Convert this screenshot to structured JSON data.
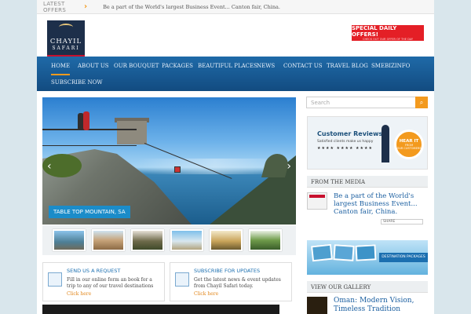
{
  "ticker": {
    "label": "LATEST OFFERS",
    "text": "Be a part of the World's largest Business Event... Canton fair, China."
  },
  "logo": {
    "line1": "CHAYIL",
    "line2": "SAFARI"
  },
  "header_banner": {
    "title": "SPECIAL DAILY OFFERS!",
    "subtitle": "CHECK OUT OUR OFFER OF THE DAY"
  },
  "nav": {
    "items": [
      "HOME",
      "ABOUT US",
      "OUR BOUQUET",
      "PACKAGES",
      "BEAUTIFUL PLACES",
      "NEWS",
      "CONTACT US",
      "TRAVEL BLOG",
      "SMEBIZINFO",
      "SUBSCRIBE NOW"
    ],
    "active": "HOME"
  },
  "slider": {
    "caption": "TABLE TOP MOUNTAIN, SA"
  },
  "boxes": {
    "request": {
      "title": "SEND US A REQUEST",
      "text": "Fill in our online form an book for a trip to any of our travel destinations",
      "link": "Click here"
    },
    "subscribe": {
      "title": "SUBSCRIBE FOR UPDATES",
      "text": "Get the latest news & event updates from Chayil Safari today.",
      "link": "Click here"
    }
  },
  "sidebar": {
    "search_placeholder": "Search",
    "reviews": {
      "title": "Customer Reviews",
      "subtitle": "Satisfied clients make us happy",
      "badge_line1": "HEAR IT",
      "badge_line2": "FROM",
      "badge_line3": "OUR CUSTOMERS"
    },
    "media": {
      "heading": "FROM THE MEDIA",
      "title": "Be a part of the World's largest Business Event... Canton fair, China.",
      "share": "SHARE"
    },
    "packages_label": "DESTINATION PACKAGES",
    "gallery": {
      "heading": "VIEW OUR GALLERY",
      "title": "Oman: Modern Vision, Timeless Tradition"
    }
  },
  "colors": {
    "accent_orange": "#f39a1e",
    "nav_blue": "#1f6aa8",
    "link_blue": "#1b5fa0",
    "offer_red": "#e41f26"
  }
}
